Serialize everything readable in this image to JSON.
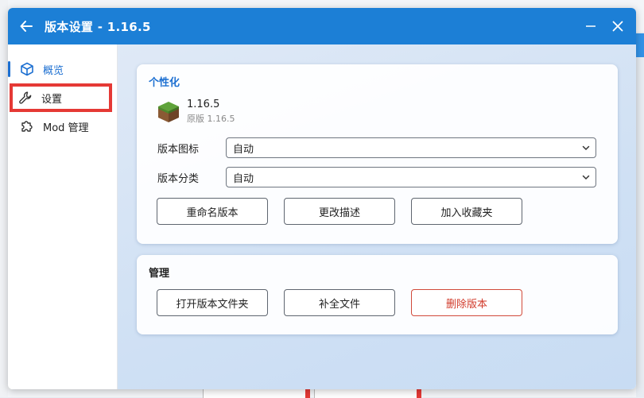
{
  "window": {
    "title": "版本设置 - 1.16.5"
  },
  "sidebar": {
    "items": [
      {
        "label": "概览",
        "icon": "cube-icon"
      },
      {
        "label": "设置",
        "icon": "wrench-icon"
      },
      {
        "label": "Mod 管理",
        "icon": "puzzle-icon"
      }
    ]
  },
  "personalize": {
    "title": "个性化",
    "version_name": "1.16.5",
    "version_sub": "原版 1.16.5",
    "icon_label": "版本图标",
    "icon_value": "自动",
    "category_label": "版本分类",
    "category_value": "自动",
    "buttons": [
      "重命名版本",
      "更改描述",
      "加入收藏夹"
    ]
  },
  "manage": {
    "title": "管理",
    "buttons": [
      "打开版本文件夹",
      "补全文件",
      "删除版本"
    ]
  },
  "colors": {
    "accent": "#1c7fd6",
    "highlight": "#e53935",
    "danger": "#d13a2a"
  }
}
